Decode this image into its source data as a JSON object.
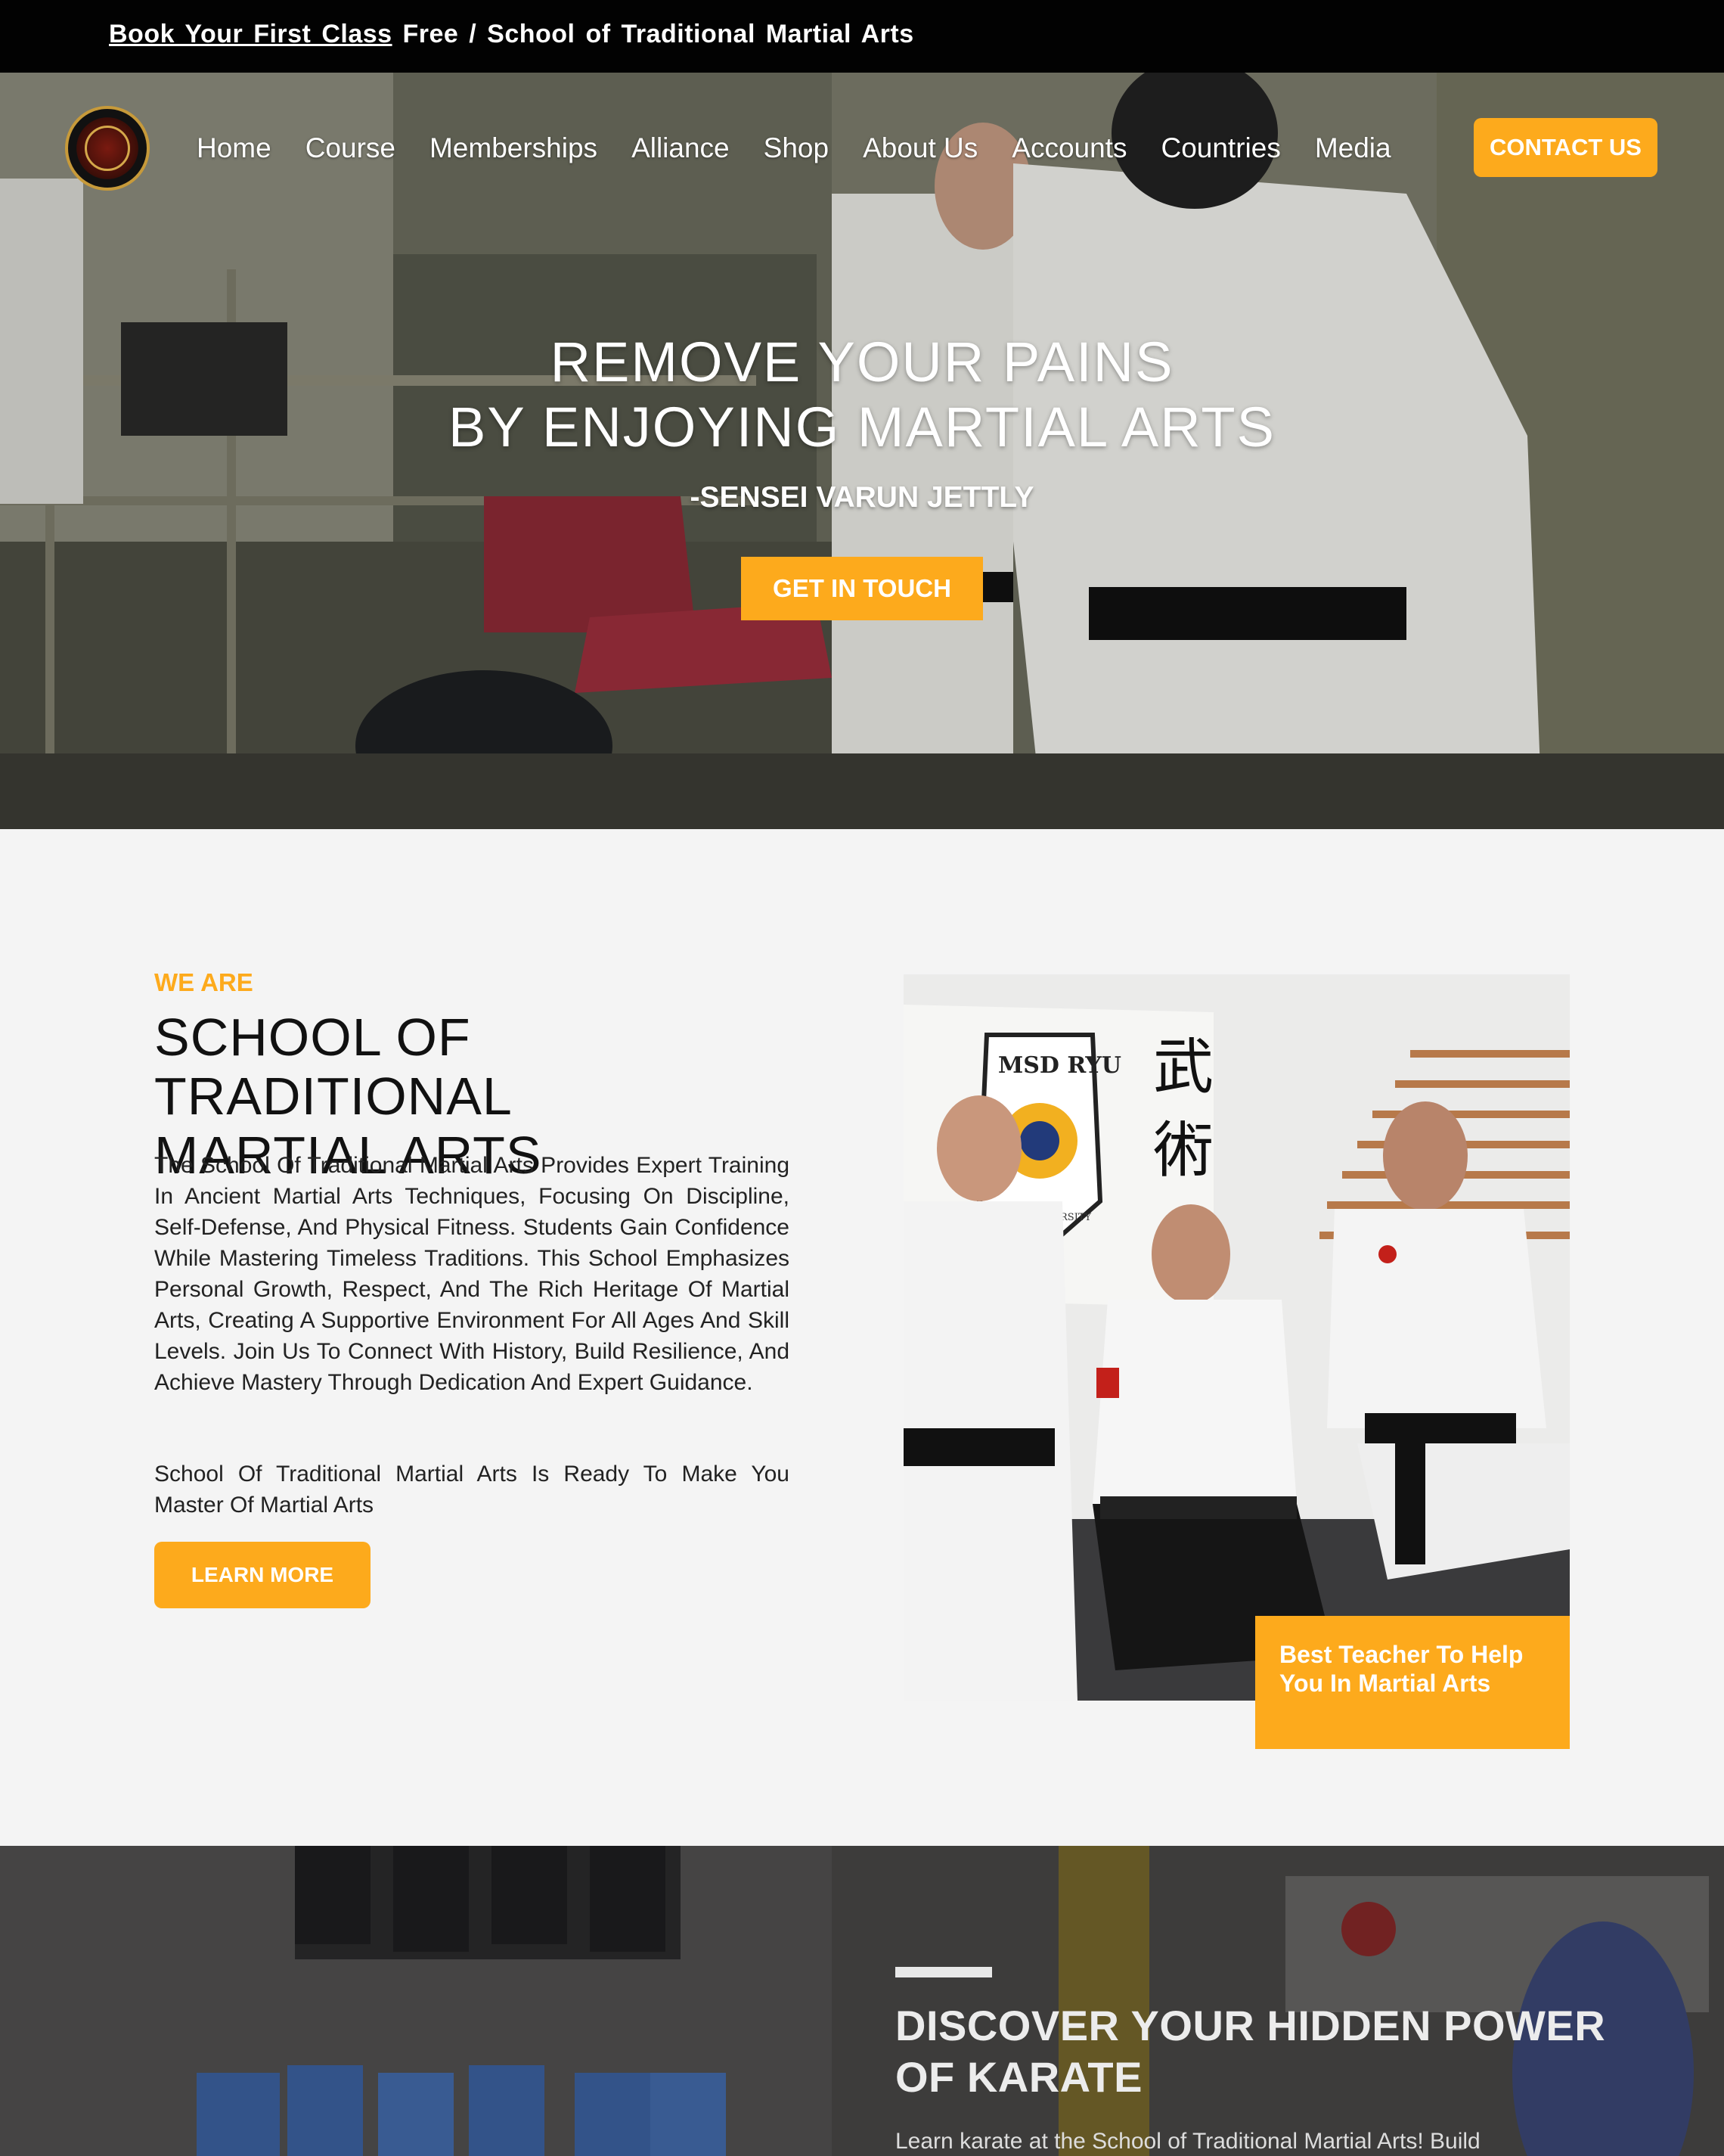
{
  "announcement": {
    "link_text": "Book Your First Class",
    "rest_text": " Free / School of Traditional Martial Arts"
  },
  "nav": {
    "items": [
      {
        "label": "Home"
      },
      {
        "label": "Course"
      },
      {
        "label": "Memberships"
      },
      {
        "label": "Alliance"
      },
      {
        "label": "Shop"
      },
      {
        "label": "About Us"
      },
      {
        "label": "Accounts"
      },
      {
        "label": "Countries"
      },
      {
        "label": "Media"
      }
    ],
    "contact_label": "CONTACT US"
  },
  "hero": {
    "title_line1": "REMOVE YOUR PAINS",
    "title_line2": "BY ENJOYING MARTIAL ARTS",
    "subtitle": "-SENSEI VARUN JETTLY",
    "cta_label": "GET IN TOUCH"
  },
  "about": {
    "eyebrow": "WE ARE",
    "title_line1": "SCHOOL OF TRADITIONAL",
    "title_line2": "MARTIAL ARTS",
    "body": "The School Of Traditional Martial Arts Provides Expert Training In Ancient Martial Arts Techniques, Focusing On Discipline, Self-Defense, And Physical Fitness. Students Gain Confidence While Mastering Timeless Traditions. This School Emphasizes Personal Growth, Respect, And The Rich Heritage Of Martial Arts, Creating A Supportive Environment For All Ages And Skill Levels. Join Us To Connect With History, Build Resilience, And Achieve Mastery Through Dedication And Expert Guidance.",
    "body2": "School Of Traditional Martial Arts Is Ready To Make You Master Of Martial Arts",
    "cta_label": "LEARN MORE",
    "photo_banner_text": "MSD RYU",
    "photo_banner_subtext": "ARTS UNIVERSITY",
    "photo_caption": "Best Teacher To Help You In Martial Arts"
  },
  "power": {
    "title_line1": "DISCOVER YOUR HIDDEN POWER",
    "title_line2": "OF KARATE",
    "body": "Learn karate at the School of Traditional Martial Arts! Build"
  },
  "colors": {
    "accent": "#fdaa1c",
    "topbar": "#020202",
    "section_bg": "#f4f4f4"
  },
  "icons": {
    "logo": "dojo-emblem-icon"
  }
}
